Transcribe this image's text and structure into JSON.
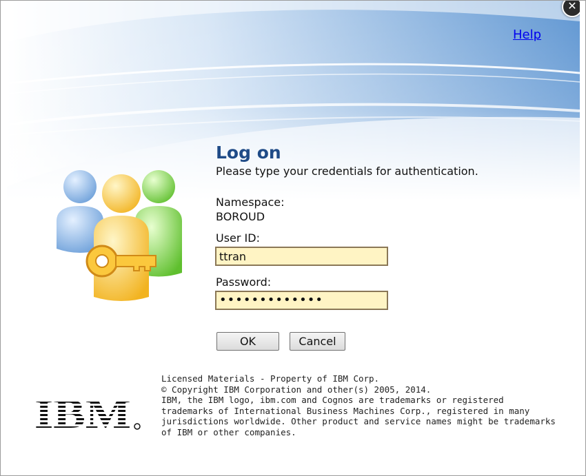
{
  "dialog": {
    "close_label": "✕",
    "help_label": "Help",
    "title": "Log on",
    "subtitle": "Please type your credentials for authentication.",
    "namespace_label": "Namespace:",
    "namespace_value": "BOROUD",
    "userid_label": "User ID:",
    "userid_value": "ttran",
    "password_label": "Password:",
    "password_mask": "•••••••••••••",
    "ok_label": "OK",
    "cancel_label": "Cancel"
  },
  "footer": {
    "logo_text": "IBM",
    "legal_lines": [
      "Licensed Materials - Property of IBM Corp.",
      "© Copyright IBM Corporation and other(s) 2005, 2014.",
      "IBM, the IBM logo, ibm.com and Cognos are trademarks or registered",
      "trademarks of International Business Machines Corp., registered in many",
      "jurisdictions worldwide. Other product and service names might be trademarks",
      "of IBM or other companies."
    ]
  },
  "colors": {
    "title": "#1f4b87",
    "field_bg": "#fff4c4",
    "field_border": "#8a7756",
    "banner_blue": "#6aa0d8"
  }
}
